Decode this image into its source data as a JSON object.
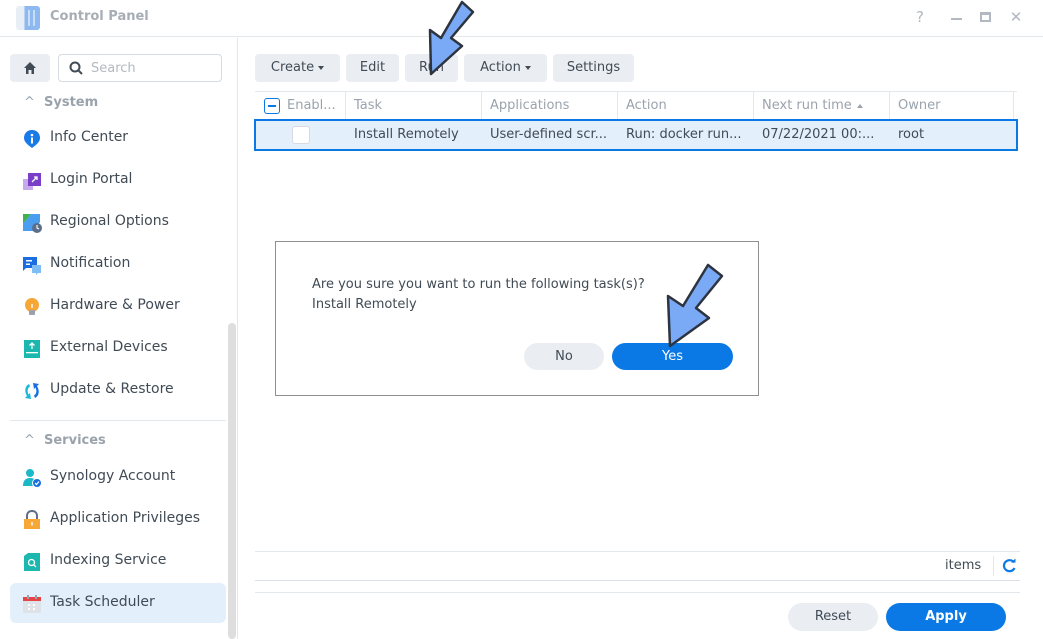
{
  "window": {
    "title": "Control Panel",
    "controls": {
      "help": "?",
      "minimize": "minimize",
      "maximize": "maximize",
      "close": "✕"
    }
  },
  "sidebar": {
    "search_placeholder": "Search",
    "sections": [
      {
        "label": "System",
        "items": [
          {
            "label": "Info Center",
            "icon": "info-icon"
          },
          {
            "label": "Login Portal",
            "icon": "login-portal-icon"
          },
          {
            "label": "Regional Options",
            "icon": "regional-options-icon"
          },
          {
            "label": "Notification",
            "icon": "notification-icon"
          },
          {
            "label": "Hardware & Power",
            "icon": "hardware-power-icon"
          },
          {
            "label": "External Devices",
            "icon": "external-devices-icon"
          },
          {
            "label": "Update & Restore",
            "icon": "update-restore-icon"
          }
        ]
      },
      {
        "label": "Services",
        "items": [
          {
            "label": "Synology Account",
            "icon": "synology-account-icon"
          },
          {
            "label": "Application Privileges",
            "icon": "application-privileges-icon"
          },
          {
            "label": "Indexing Service",
            "icon": "indexing-service-icon"
          },
          {
            "label": "Task Scheduler",
            "icon": "task-scheduler-icon",
            "active": true
          }
        ]
      }
    ]
  },
  "toolbar": {
    "create": "Create",
    "edit": "Edit",
    "run": "Run",
    "action": "Action",
    "settings": "Settings"
  },
  "table": {
    "columns": [
      "Enabl...",
      "Task",
      "Applications",
      "Action",
      "Next run time",
      "Owner"
    ],
    "sorted_column": "Next run time",
    "sort_direction": "ascending",
    "rows": [
      {
        "enabled": false,
        "task": "Install Remotely",
        "applications": "User-defined scr...",
        "action": "Run: docker run...",
        "next_run_time": "07/22/2021 00:...",
        "owner": "root",
        "selected": true
      }
    ],
    "footer": {
      "items_label": "items"
    }
  },
  "footer": {
    "reset": "Reset",
    "apply": "Apply"
  },
  "dialog": {
    "message": "Are you sure you want to run the following task(s)?",
    "task_name": "Install Remotely",
    "no": "No",
    "yes": "Yes"
  },
  "colors": {
    "accent": "#0a79e6",
    "selected_row": "#e4effc",
    "button_bg": "#eaeef3",
    "annotation_arrow": "#7aaaf5"
  }
}
